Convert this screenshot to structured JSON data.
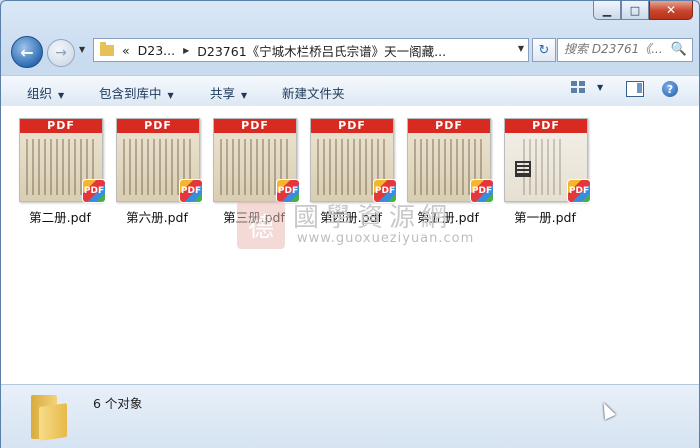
{
  "window": {
    "caption_buttons": {
      "minimize": "▁",
      "maximize": "□",
      "close": "✕"
    }
  },
  "nav": {
    "back_glyph": "←",
    "forward_glyph": "→",
    "history_dropdown": "▼",
    "breadcrumb": [
      "«",
      "D23...",
      "D23761《宁城木栏桥吕氏宗谱》天一阁藏..."
    ],
    "crumb_sep": "▶",
    "address_dropdown": "▼",
    "refresh_glyph": "↻",
    "search_placeholder": "搜索 D23761《...",
    "search_icon": "🔍"
  },
  "toolbar": {
    "organize": "组织",
    "include_in_library": "包含到库中",
    "share": "共享",
    "new_folder": "新建文件夹",
    "dropdown_glyph": "▼",
    "help_glyph": "?"
  },
  "files": [
    {
      "name": "第二册.pdf",
      "badge": "PDF"
    },
    {
      "name": "第六册.pdf",
      "badge": "PDF"
    },
    {
      "name": "第三册.pdf",
      "badge": "PDF"
    },
    {
      "name": "第四册.pdf",
      "badge": "PDF"
    },
    {
      "name": "第五册.pdf",
      "badge": "PDF"
    },
    {
      "name": "第一册.pdf",
      "badge": "PDF"
    }
  ],
  "file_badge_text": "PDF",
  "watermark": {
    "logo_char": "德",
    "chinese": "國學資源網",
    "url": "www.guoxueziyuan.com"
  },
  "status": {
    "object_count": "6 个对象"
  }
}
